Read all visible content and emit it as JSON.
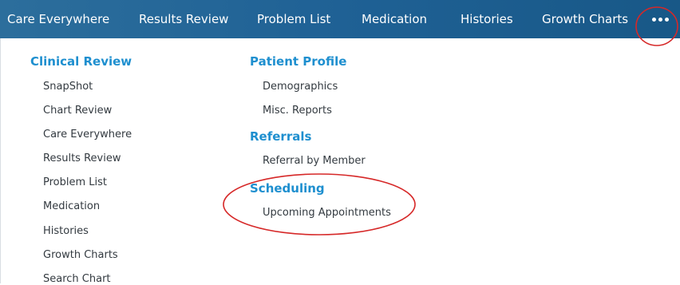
{
  "tabs": [
    "Care Everywhere",
    "Results Review",
    "Problem List",
    "Medication",
    "Histories",
    "Growth Charts"
  ],
  "more_icon": "ellipsis-icon",
  "columns": {
    "clinical_review": {
      "heading": "Clinical Review",
      "items": [
        "SnapShot",
        "Chart Review",
        "Care Everywhere",
        "Results Review",
        "Problem List",
        "Medication",
        "Histories",
        "Growth Charts",
        "Search Chart"
      ]
    },
    "patient_profile": {
      "heading": "Patient Profile",
      "items": [
        "Demographics",
        "Misc. Reports"
      ]
    },
    "referrals": {
      "heading": "Referrals",
      "items": [
        "Referral by Member"
      ]
    },
    "scheduling": {
      "heading": "Scheduling",
      "items": [
        "Upcoming Appointments"
      ]
    }
  },
  "annotation_color": "#d62828"
}
